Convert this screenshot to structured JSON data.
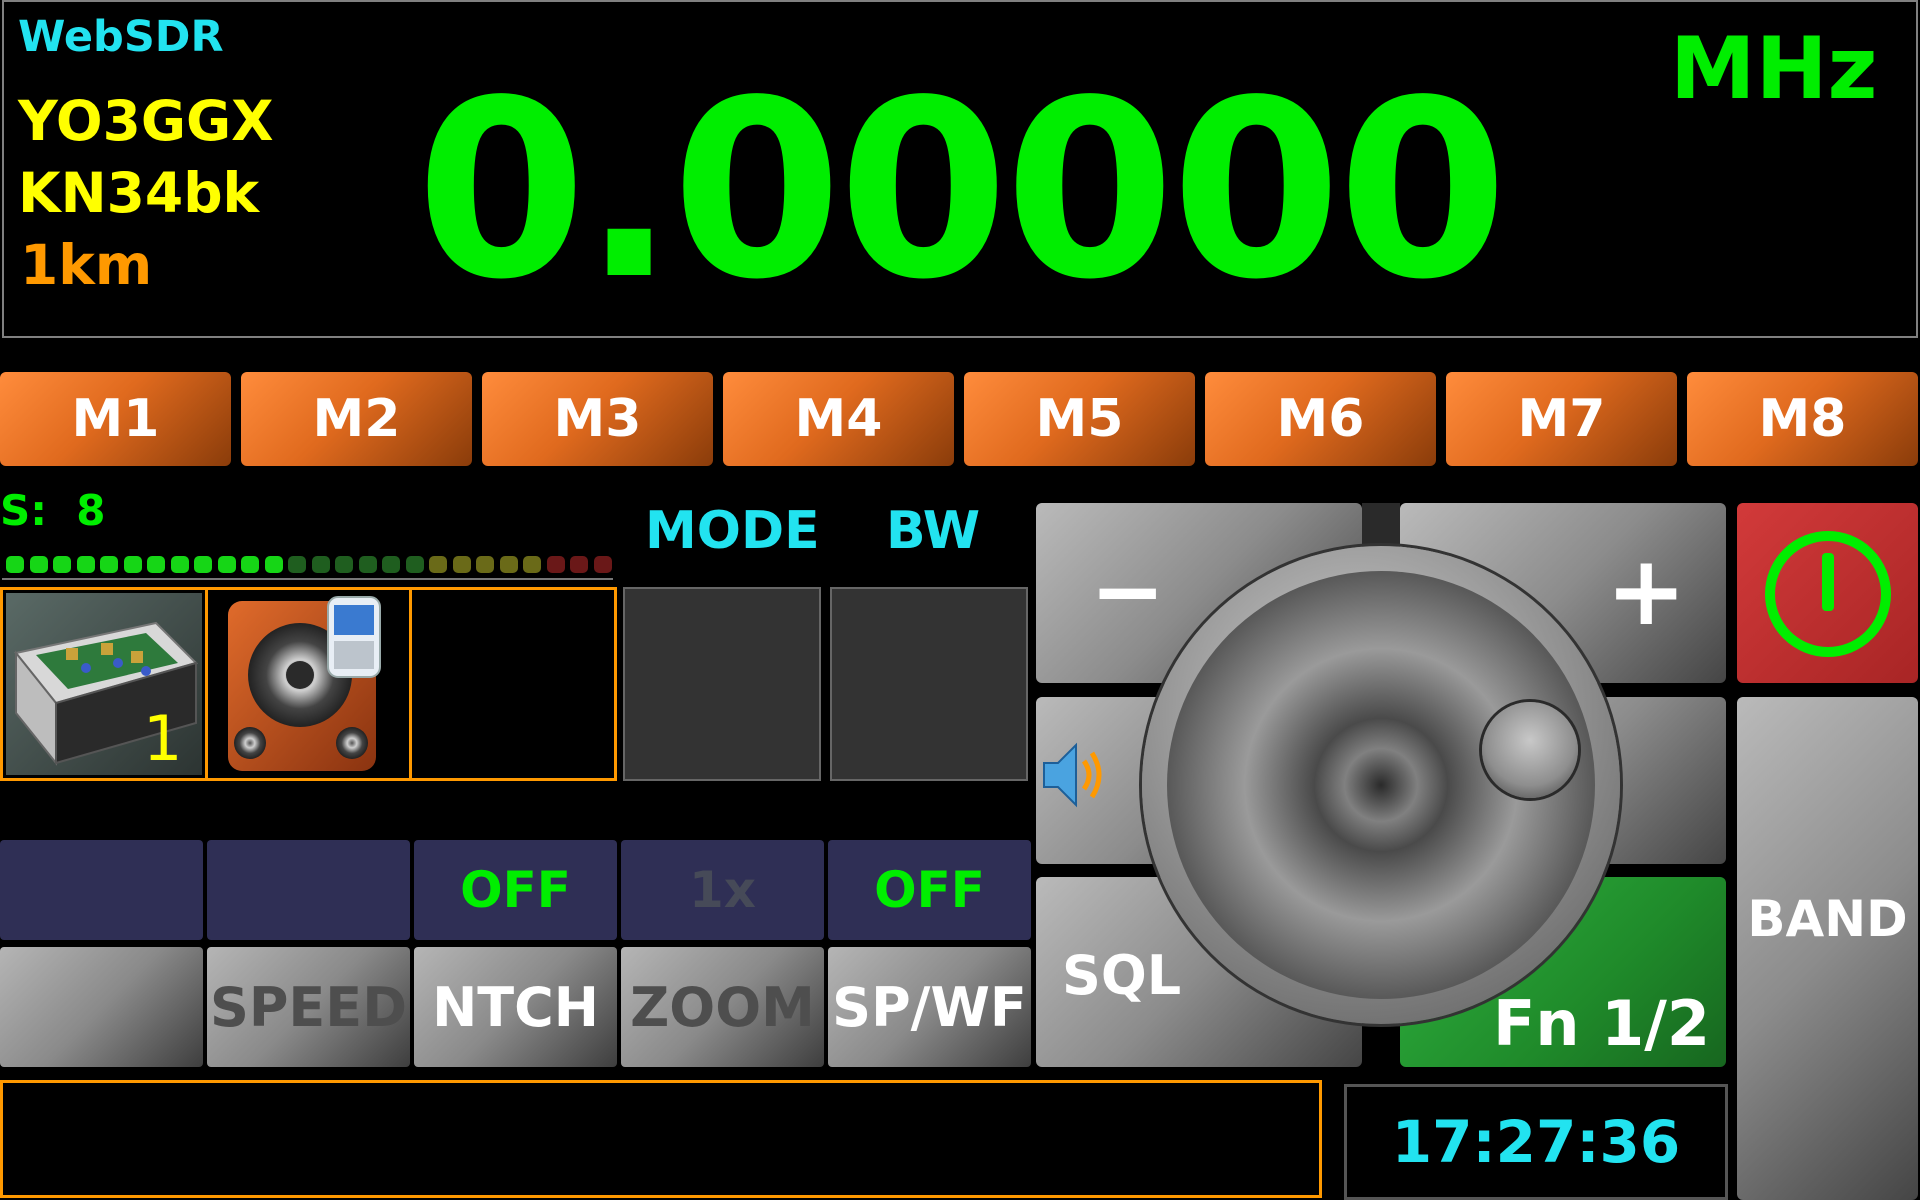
{
  "display": {
    "source": "WebSDR",
    "callsign": "YO3GGX",
    "locator": "KN34bk",
    "distance": "1km",
    "frequency": "0.00000",
    "unit": "MHz"
  },
  "memories": [
    "M1",
    "M2",
    "M3",
    "M4",
    "M5",
    "M6",
    "M7",
    "M8"
  ],
  "smeter": {
    "label": "S:",
    "value": "8",
    "active_segments": 12,
    "total_segments": 26
  },
  "headers": {
    "mode": "MODE",
    "bw": "BW"
  },
  "tiles": {
    "radio_number": "1"
  },
  "toggles": {
    "first": "",
    "second": "",
    "notch_state": "OFF",
    "zoom_state": "1x",
    "spwf_state": "OFF"
  },
  "buttons": {
    "blank": "",
    "speed": "SPEED",
    "notch": "NTCH",
    "zoom": "ZOOM",
    "spwf": "SP/WF",
    "minus": "−",
    "plus": "+",
    "sql": "SQL",
    "fn": "Fn 1/2",
    "band": "BAND"
  },
  "clock": "17:27:36",
  "colors": {
    "freq_green": "#00ee00",
    "cyan": "#22e3f0",
    "orange": "#ff9900",
    "power_red": "#c83232",
    "fn_green": "#1f9a2c"
  },
  "icons": {
    "power": "power-icon",
    "speaker": "speaker-icon",
    "radio": "radio-hardware-image",
    "audio": "speaker-phone-image"
  }
}
